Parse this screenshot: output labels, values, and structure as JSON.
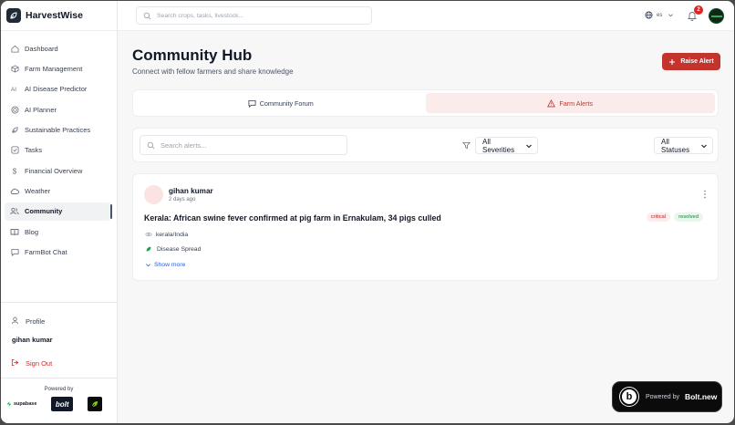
{
  "app": {
    "name": "HarvestWise"
  },
  "sidebar": {
    "items": [
      {
        "label": "Dashboard",
        "icon": "home-icon"
      },
      {
        "label": "Farm Management",
        "icon": "box-icon"
      },
      {
        "label": "AI Disease Predictor",
        "icon": "ai-icon"
      },
      {
        "label": "AI Planner",
        "icon": "target-icon"
      },
      {
        "label": "Sustainable Practices",
        "icon": "leaf-icon"
      },
      {
        "label": "Tasks",
        "icon": "checkbox-icon"
      },
      {
        "label": "Financial Overview",
        "icon": "dollar-icon"
      },
      {
        "label": "Weather",
        "icon": "cloud-icon"
      },
      {
        "label": "Community",
        "icon": "users-icon",
        "active": true
      },
      {
        "label": "Blog",
        "icon": "book-icon"
      },
      {
        "label": "FarmBot Chat",
        "icon": "chat-icon"
      }
    ],
    "profile_label": "Profile",
    "user_name": "gihan kumar",
    "signout_label": "Sign Out",
    "powered_label": "Powered by",
    "sponsors": {
      "supabase": "supabase",
      "bolt": "bolt"
    }
  },
  "topbar": {
    "search_placeholder": "Search crops, tasks, livestock...",
    "language": "es",
    "notification_count": "2"
  },
  "page": {
    "title": "Community Hub",
    "subtitle": "Connect with fellow farmers and share knowledge",
    "raise_alert_label": "Raise Alert"
  },
  "tabs": [
    {
      "label": "Community Forum",
      "active": false
    },
    {
      "label": "Farm Alerts",
      "active": true
    }
  ],
  "filters": {
    "search_placeholder": "Search alerts...",
    "severity_value": "All Severities",
    "status_value": "All Statuses"
  },
  "alerts": [
    {
      "author": "gihan kumar",
      "time": "2 days ago",
      "title": "Kerala: African swine fever confirmed at pig farm in Ernakulam, 34 pigs culled",
      "severity": "critical",
      "status": "resolved",
      "location": "kerala/India",
      "category": "Disease Spread",
      "show_more": "Show more"
    }
  ],
  "bolt_badge": {
    "powered": "Powered by",
    "brand": "Bolt.new",
    "letter": "b"
  },
  "colors": {
    "accent": "#c5342c",
    "active_tab_bg": "#fbeceb",
    "link": "#2563eb"
  }
}
